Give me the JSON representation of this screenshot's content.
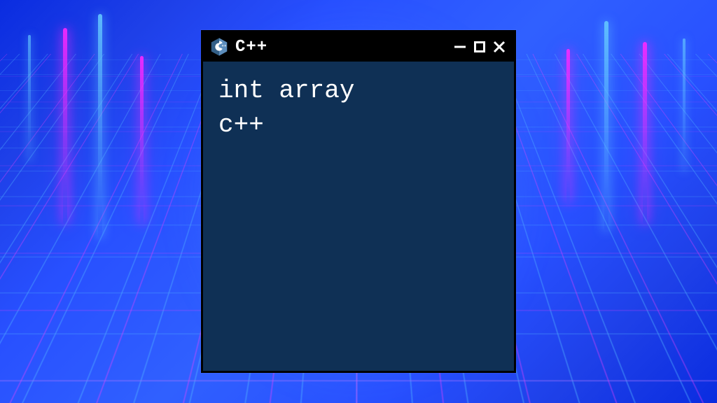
{
  "titlebar": {
    "title": "C++",
    "logo_label": "cpp-logo"
  },
  "code": {
    "line1": "int array",
    "line2": "c++"
  },
  "colors": {
    "terminal_bg": "#0f3055",
    "titlebar_bg": "#000000",
    "text": "#ffffff",
    "logo_blue": "#5c8dbc"
  }
}
